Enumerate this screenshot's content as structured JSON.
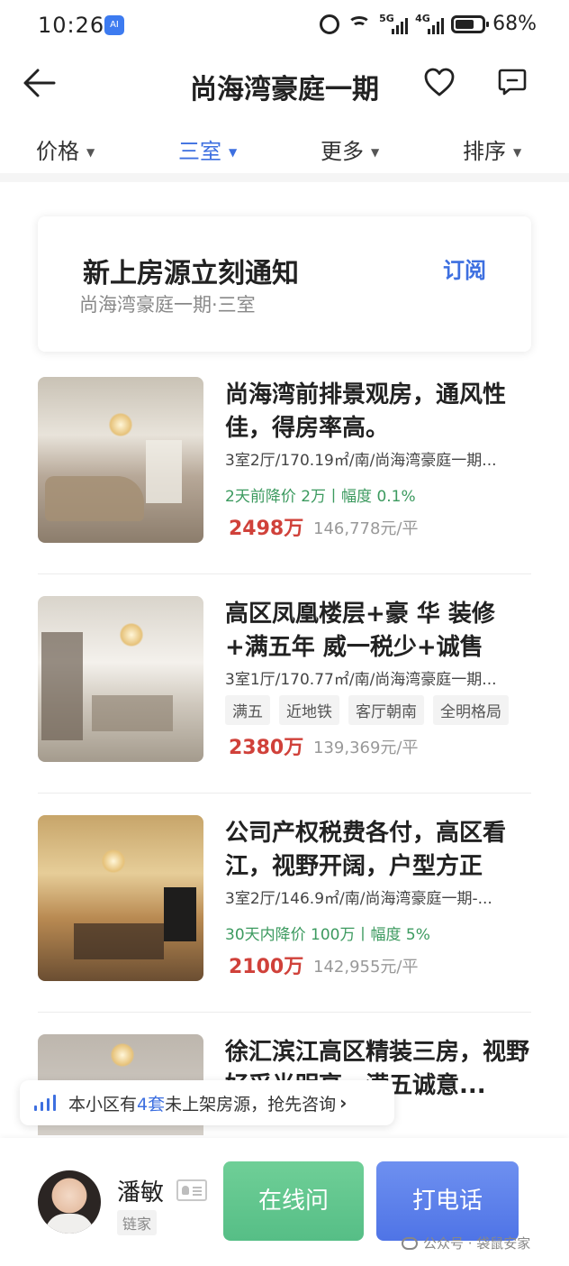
{
  "status_bar": {
    "time": "10:26",
    "badge": "AI",
    "signal1_label": "5G",
    "signal2_label": "4G",
    "battery": "68%"
  },
  "header": {
    "title": "尚海湾豪庭一期"
  },
  "filters": [
    {
      "label": "价格",
      "active": false
    },
    {
      "label": "三室",
      "active": true
    },
    {
      "label": "更多",
      "active": false
    },
    {
      "label": "排序",
      "active": false
    }
  ],
  "subscribe": {
    "title": "新上房源立刻通知",
    "subtitle": "尚海湾豪庭一期·三室",
    "button": "订阅"
  },
  "listings": [
    {
      "title": "尚海湾前排景观房，通风性佳，得房率高。",
      "meta": "3室2厅/170.19㎡/南/尚海湾豪庭一期...",
      "drop": "2天前降价 2万丨幅度 0.1%",
      "price": "2498万",
      "unit_price": "146,778元/平"
    },
    {
      "title": "高区凤凰楼层+豪 华 装修+满五年 威一税少+诚售",
      "meta": "3室1厅/170.77㎡/南/尚海湾豪庭一期...",
      "tags": [
        "满五",
        "近地铁",
        "客厅朝南",
        "全明格局"
      ],
      "price": "2380万",
      "unit_price": "139,369元/平"
    },
    {
      "title": "公司产权税费各付，高区看江，视野开阔，户型方正",
      "meta": "3室2厅/146.9㎡/南/尚海湾豪庭一期-...",
      "drop": "30天内降价 100万丨幅度 5%",
      "price": "2100万",
      "unit_price": "142,955元/平"
    },
    {
      "title": "徐汇滨江高区精装三房，视野好采光明亮，满五诚意..."
    }
  ],
  "toast": {
    "prefix": "本小区有",
    "count": "4套",
    "suffix": "未上架房源，抢先咨询"
  },
  "agent": {
    "name": "潘敏",
    "org": "链家",
    "chat_button": "在线问",
    "call_button": "打电话"
  },
  "watermark": "公众号 · 袋鼠安家",
  "colors": {
    "accent": "#3d6fe0",
    "price": "#d0413a",
    "drop": "#3c9a5f",
    "chat_button": "#56be86",
    "call_button": "#4f74e6"
  }
}
